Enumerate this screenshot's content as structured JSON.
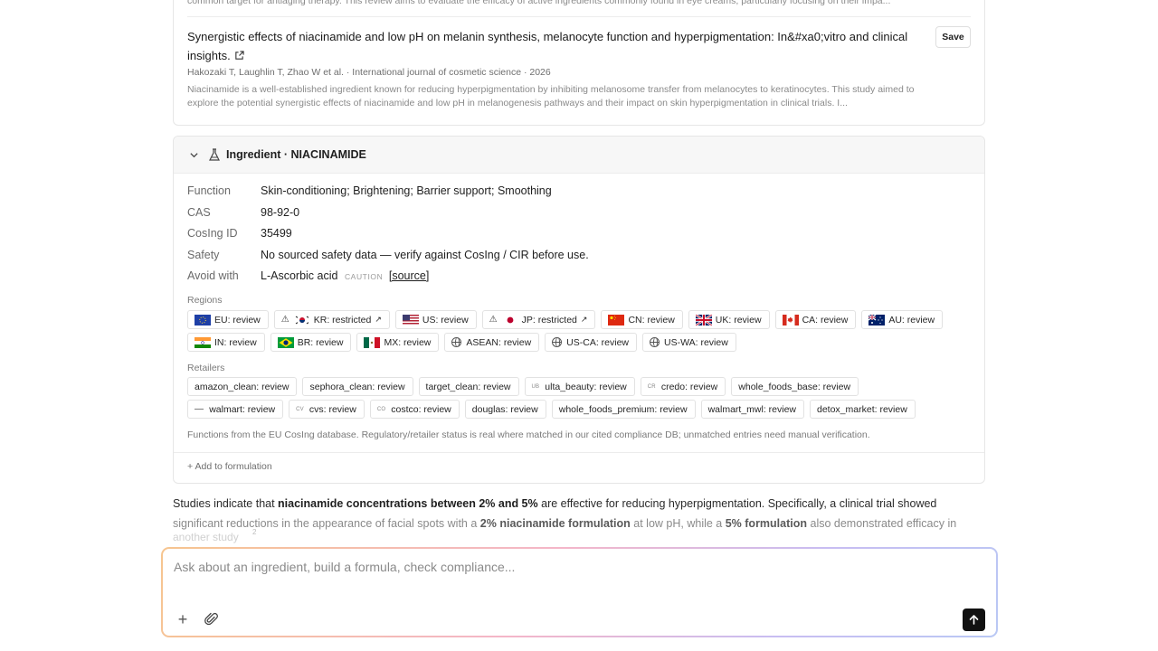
{
  "previous_paper": {
    "snippet": "common target for antiaging therapy. This review aims to evaluate the efficacy of active ingredients commonly found in eye creams, particularly focusing on their impa..."
  },
  "paper": {
    "title": "Synergistic effects of niacinamide and low pH on melanin synthesis, melanocyte function and hyperpigmentation: In&#xa0;vitro and clinical insights.",
    "save_label": "Save",
    "meta": "Hakozaki T, Laughlin T, Zhao W et al. · International journal of cosmetic science · 2026",
    "abstract": "Niacinamide is a well-established ingredient known for reducing hyperpigmentation by inhibiting melanosome transfer from melanocytes to keratinocytes. This study aimed to explore the potential synergistic effects of niacinamide and low pH in melanogenesis pathways and their impact on skin hyperpigmentation in clinical trials. I..."
  },
  "ingredient": {
    "header": "Ingredient · NIACINAMIDE",
    "fields": [
      {
        "key": "Function",
        "value": "Skin-conditioning; Brightening; Barrier support; Smoothing"
      },
      {
        "key": "CAS",
        "value": "98-92-0"
      },
      {
        "key": "CosIng ID",
        "value": "35499"
      },
      {
        "key": "Safety",
        "value": "No sourced safety data — verify against CosIng / CIR before use."
      },
      {
        "key": "Avoid with",
        "value": "L-Ascorbic acid",
        "tag": "CAUTION",
        "link": "[source]"
      }
    ],
    "regions_label": "Regions",
    "regions": [
      {
        "label": "EU: review",
        "icon": "eu-flag"
      },
      {
        "label": "KR: restricted",
        "icon": "kr-flag",
        "warning": true,
        "external": true
      },
      {
        "label": "US: review",
        "icon": "us-flag"
      },
      {
        "label": "JP: restricted",
        "icon": "jp-flag",
        "warning": true,
        "external": true
      },
      {
        "label": "CN: review",
        "icon": "cn-flag"
      },
      {
        "label": "UK: review",
        "icon": "uk-flag"
      },
      {
        "label": "CA: review",
        "icon": "ca-flag"
      },
      {
        "label": "AU: review",
        "icon": "au-flag"
      },
      {
        "label": "IN: review",
        "icon": "in-flag"
      },
      {
        "label": "BR: review",
        "icon": "br-flag"
      },
      {
        "label": "MX: review",
        "icon": "mx-flag"
      },
      {
        "label": "ASEAN: review",
        "icon": "globe-icon"
      },
      {
        "label": "US-CA: review",
        "icon": "globe-icon"
      },
      {
        "label": "US-WA: review",
        "icon": "globe-icon"
      }
    ],
    "retailers_label": "Retailers",
    "retailers": [
      {
        "label": "amazon_clean: review"
      },
      {
        "label": "sephora_clean: review"
      },
      {
        "label": "target_clean: review"
      },
      {
        "label": "ulta_beauty: review",
        "mini": "UB"
      },
      {
        "label": "credo: review",
        "mini": "CR"
      },
      {
        "label": "whole_foods_base: review"
      },
      {
        "label": "walmart: review",
        "mini": "—"
      },
      {
        "label": "cvs: review",
        "mini": "CV"
      },
      {
        "label": "costco: review",
        "mini": "CO"
      },
      {
        "label": "douglas: review"
      },
      {
        "label": "whole_foods_premium: review"
      },
      {
        "label": "walmart_mwl: review"
      },
      {
        "label": "detox_market: review"
      }
    ],
    "footnote": "Functions from the EU CosIng database. Regulatory/retailer status is real where matched in our cited compliance DB; unmatched entries need manual verification.",
    "add_label": "+ Add to formulation"
  },
  "answer": {
    "p1_a": "Studies indicate that ",
    "p1_b": "niacinamide concentrations between 2% and 5%",
    "p1_c": " are effective for reducing hyperpigmentation. Specifically, a clinical trial showed",
    "p2_a": "significant reductions in the appearance of facial spots with a ",
    "p2_b": "2% niacinamide formulation",
    "p2_c": " at low pH, while a ",
    "p2_d": "5% formulation",
    "p2_e": " also demonstrated efficacy in",
    "p3": "another study",
    "cite": "2"
  },
  "composer": {
    "placeholder": "Ask about an ingredient, build a formula, check compliance..."
  }
}
